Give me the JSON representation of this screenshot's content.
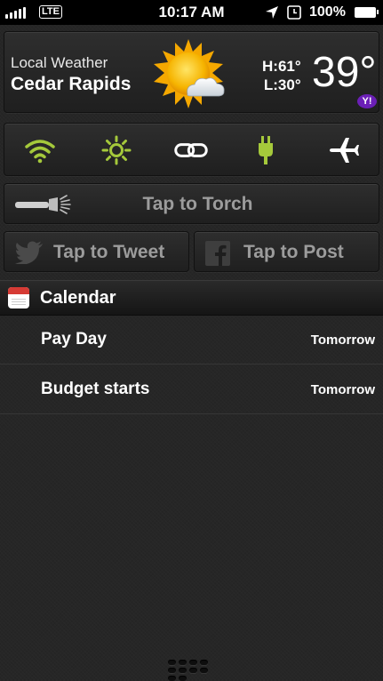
{
  "status_bar": {
    "carrier": "LTE",
    "time": "10:17 AM",
    "battery_percent": "100%",
    "icons": [
      "signal-icon",
      "location-arrow-icon",
      "alarm-icon",
      "battery-icon"
    ]
  },
  "weather": {
    "title": "Local Weather",
    "city": "Cedar Rapids",
    "high": "H:61°",
    "low": "L:30°",
    "temperature": "39°",
    "condition_icon": "sun-cloud-icon",
    "provider_badge": "Y!"
  },
  "toggles": [
    {
      "name": "wifi",
      "icon": "wifi-icon",
      "color": "#a5c93b"
    },
    {
      "name": "brightness",
      "icon": "brightness-icon",
      "color": "#a5c93b"
    },
    {
      "name": "link",
      "icon": "link-icon",
      "color": "#ffffff"
    },
    {
      "name": "power",
      "icon": "plug-icon",
      "color": "#a5c93b"
    },
    {
      "name": "airplane",
      "icon": "airplane-icon",
      "color": "#ffffff"
    }
  ],
  "torch": {
    "label": "Tap to Torch",
    "icon": "flashlight-icon"
  },
  "social": {
    "tweet_label": "Tap to Tweet",
    "post_label": "Tap to Post"
  },
  "calendar": {
    "title": "Calendar",
    "events": [
      {
        "name": "Pay Day",
        "when": "Tomorrow"
      },
      {
        "name": "Budget starts",
        "when": "Tomorrow"
      }
    ]
  },
  "colors": {
    "accent_green": "#a5c93b",
    "background": "#262626",
    "muted_text": "#9c9c9c"
  }
}
